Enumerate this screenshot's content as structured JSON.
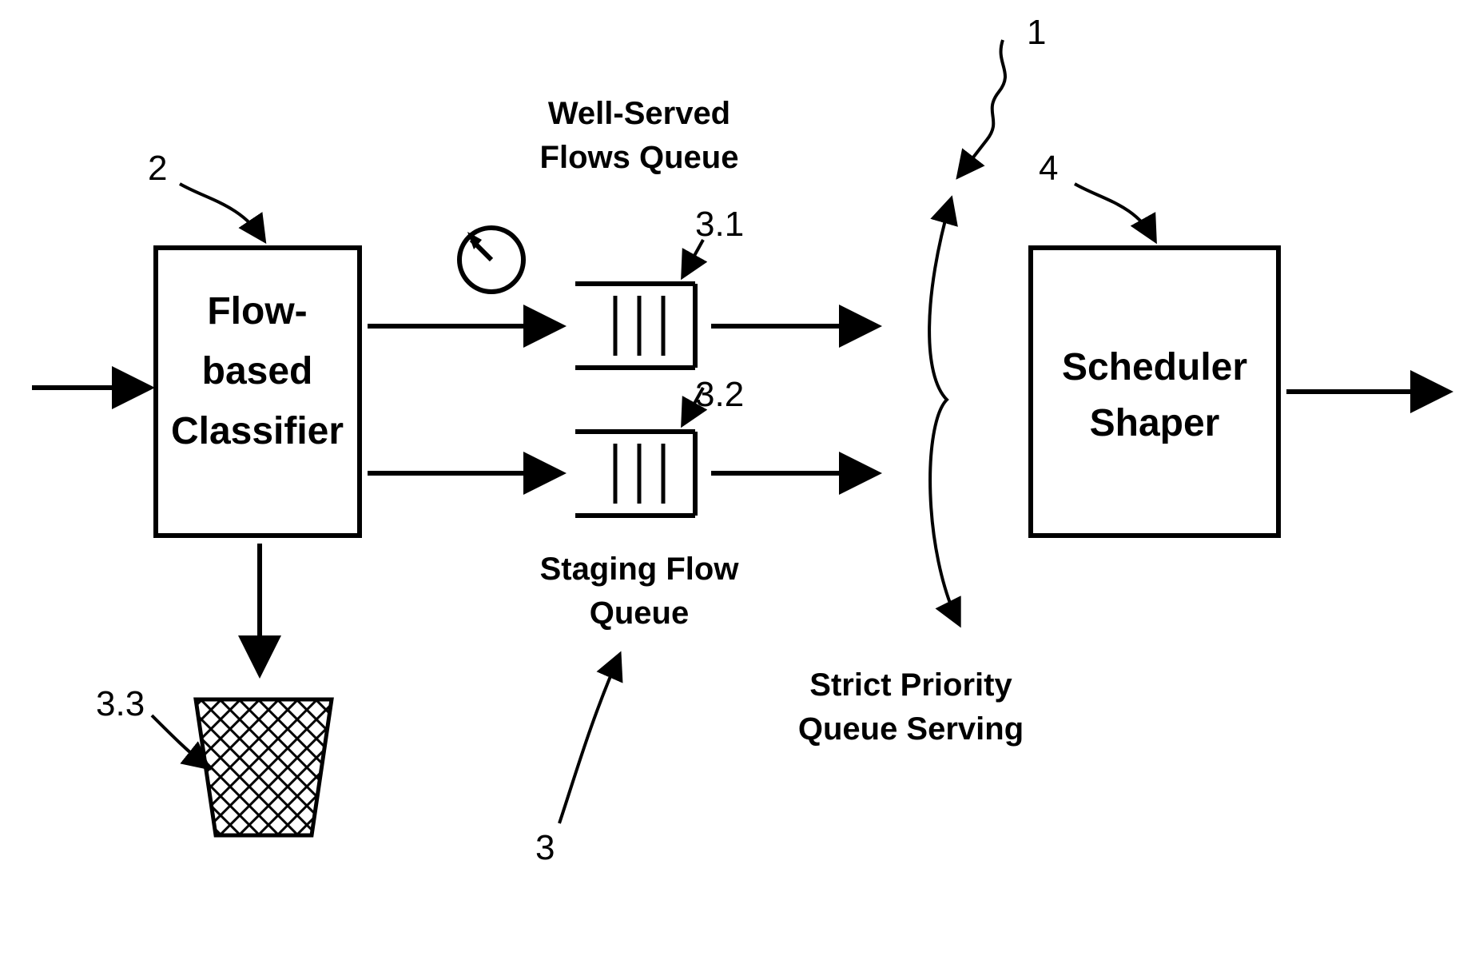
{
  "blocks": {
    "classifier": {
      "line1": "Flow-",
      "line2": "based",
      "line3": "Classifier"
    },
    "scheduler": {
      "line1": "Scheduler",
      "line2": "Shaper"
    }
  },
  "labels": {
    "wellServed": {
      "line1": "Well-Served",
      "line2": "Flows Queue"
    },
    "staging": {
      "line1": "Staging Flow",
      "line2": "Queue"
    },
    "strict": {
      "line1": "Strict Priority",
      "line2": "Queue Serving"
    }
  },
  "refs": {
    "r1": "1",
    "r2": "2",
    "r3": "3",
    "r31": "3.1",
    "r32": "3.2",
    "r33": "3.3",
    "r4": "4"
  }
}
